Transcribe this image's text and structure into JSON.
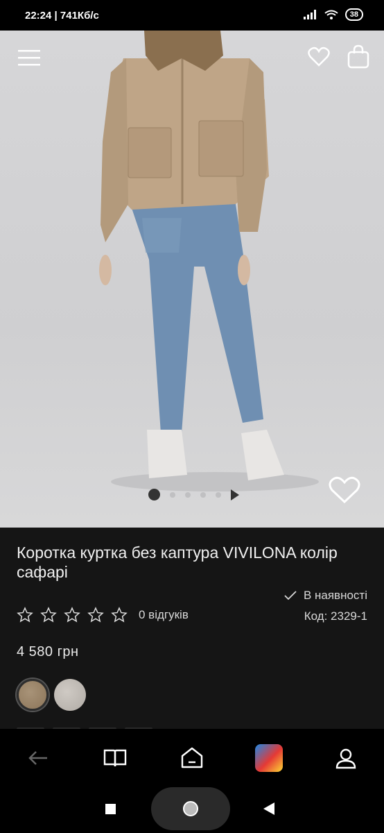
{
  "status_bar": {
    "time_speed": "22:24 | 741Кб/с",
    "battery": "38"
  },
  "product": {
    "title": "Коротка куртка без каптура VIVILONA колір сафарі",
    "availability": "В наявності",
    "reviews": "0 відгуків",
    "code": "Код: 2329-1",
    "price": "4 580 грн",
    "rating": 0,
    "gallery": {
      "total_images": 5,
      "current_image": 1
    },
    "swatches": [
      {
        "name": "сафарі",
        "color": "#9a8468"
      },
      {
        "name": "light",
        "color": "#c2bdb7"
      }
    ]
  },
  "icons": {
    "menu": "menu-icon",
    "wishlist": "heart-icon",
    "cart": "bag-icon",
    "star": "star-icon",
    "check": "check-icon"
  },
  "bottom_nav": [
    "back-arrow-icon",
    "catalog-book-icon",
    "home-icon",
    "game-app-icon",
    "profile-icon"
  ],
  "colors": {
    "background": "#151515",
    "hero": "#d3d3d5",
    "text": "#eeeeee"
  }
}
